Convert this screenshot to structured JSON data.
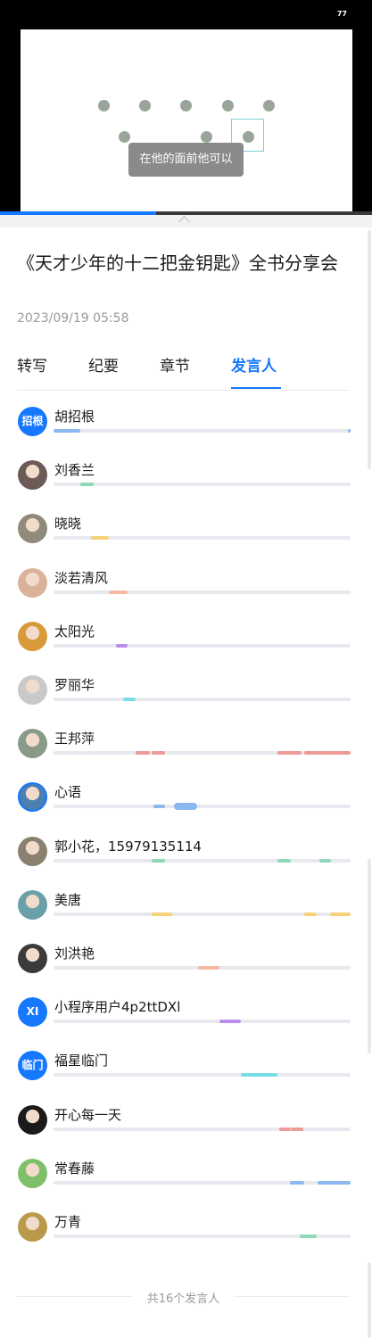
{
  "video": {
    "count": "77",
    "subtitle": "在他的面前他可以",
    "progress": 0.42
  },
  "meeting": {
    "title": "《天才少年的十二把金钥匙》全书分享会",
    "date": "2023/09/19 05:58"
  },
  "tabs": [
    {
      "label": "转写",
      "active": false
    },
    {
      "label": "纪要",
      "active": false
    },
    {
      "label": "章节",
      "active": false
    },
    {
      "label": "发言人",
      "active": true
    }
  ],
  "speakers": [
    {
      "name": "胡招根",
      "avatar_text": "招根",
      "avatar_color": "#1677ff",
      "color": "#8cb8ef",
      "segments": [
        [
          0.0,
          0.09
        ],
        [
          0.99,
          1.0
        ]
      ]
    },
    {
      "name": "刘香兰",
      "avatar_text": "",
      "avatar_color": "#6b5a55",
      "color": "#8fd9b8",
      "segments": [
        [
          0.09,
          0.135
        ]
      ]
    },
    {
      "name": "晓晓",
      "avatar_text": "",
      "avatar_color": "#8f8a7a",
      "color": "#f5d27a",
      "segments": [
        [
          0.125,
          0.185
        ]
      ]
    },
    {
      "name": "淡若清风",
      "avatar_text": "",
      "avatar_color": "#d9b29a",
      "color": "#f5b8a0",
      "segments": [
        [
          0.185,
          0.25
        ]
      ]
    },
    {
      "name": "太阳光",
      "avatar_text": "",
      "avatar_color": "#d99a3a",
      "color": "#b98ee8",
      "segments": [
        [
          0.21,
          0.25
        ]
      ]
    },
    {
      "name": "罗丽华",
      "avatar_text": "",
      "avatar_color": "#c9c9c9",
      "color": "#79dde6",
      "segments": [
        [
          0.235,
          0.275
        ]
      ]
    },
    {
      "name": "王邦萍",
      "avatar_text": "",
      "avatar_color": "#8a9a88",
      "color": "#ee9a96",
      "segments": [
        [
          0.275,
          0.325
        ],
        [
          0.33,
          0.375
        ],
        [
          0.755,
          0.835
        ],
        [
          0.845,
          1.0
        ]
      ]
    },
    {
      "name": "心语",
      "avatar_text": "",
      "avatar_color": "#4a7fb0",
      "color": "#8cb8ef",
      "ring": true,
      "segments": [
        [
          0.335,
          0.375
        ],
        [
          0.405,
          0.485
        ]
      ]
    },
    {
      "name": "郭小花，15979135114",
      "avatar_text": "",
      "avatar_color": "#8a8070",
      "color": "#8fd9b8",
      "segments": [
        [
          0.33,
          0.375
        ],
        [
          0.755,
          0.8
        ],
        [
          0.895,
          0.935
        ]
      ]
    },
    {
      "name": "美唐",
      "avatar_text": "",
      "avatar_color": "#6aa0a8",
      "color": "#f5d27a",
      "segments": [
        [
          0.33,
          0.4
        ],
        [
          0.845,
          0.885
        ],
        [
          0.93,
          1.0
        ]
      ]
    },
    {
      "name": "刘洪艳",
      "avatar_text": "",
      "avatar_color": "#3a3a3a",
      "color": "#f5b8a0",
      "segments": [
        [
          0.485,
          0.56
        ]
      ]
    },
    {
      "name": "小程序用户4p2ttDXl",
      "avatar_text": "XI",
      "avatar_color": "#1677ff",
      "color": "#b98ee8",
      "segments": [
        [
          0.56,
          0.63
        ]
      ]
    },
    {
      "name": "福星临门",
      "avatar_text": "临门",
      "avatar_color": "#1677ff",
      "color": "#79dde6",
      "segments": [
        [
          0.63,
          0.755
        ]
      ]
    },
    {
      "name": "开心每一天",
      "avatar_text": "",
      "avatar_color": "#1a1a1a",
      "color": "#ee9a96",
      "segments": [
        [
          0.76,
          0.8
        ],
        [
          0.8,
          0.84
        ]
      ]
    },
    {
      "name": "常春藤",
      "avatar_text": "",
      "avatar_color": "#7fbf6a",
      "color": "#8cb8ef",
      "segments": [
        [
          0.795,
          0.845
        ],
        [
          0.89,
          1.0
        ]
      ]
    },
    {
      "name": "万青",
      "avatar_text": "",
      "avatar_color": "#b89a4a",
      "color": "#8fd9b8",
      "segments": [
        [
          0.83,
          0.885
        ]
      ]
    }
  ],
  "footer": {
    "summary": "共16个发言人"
  }
}
